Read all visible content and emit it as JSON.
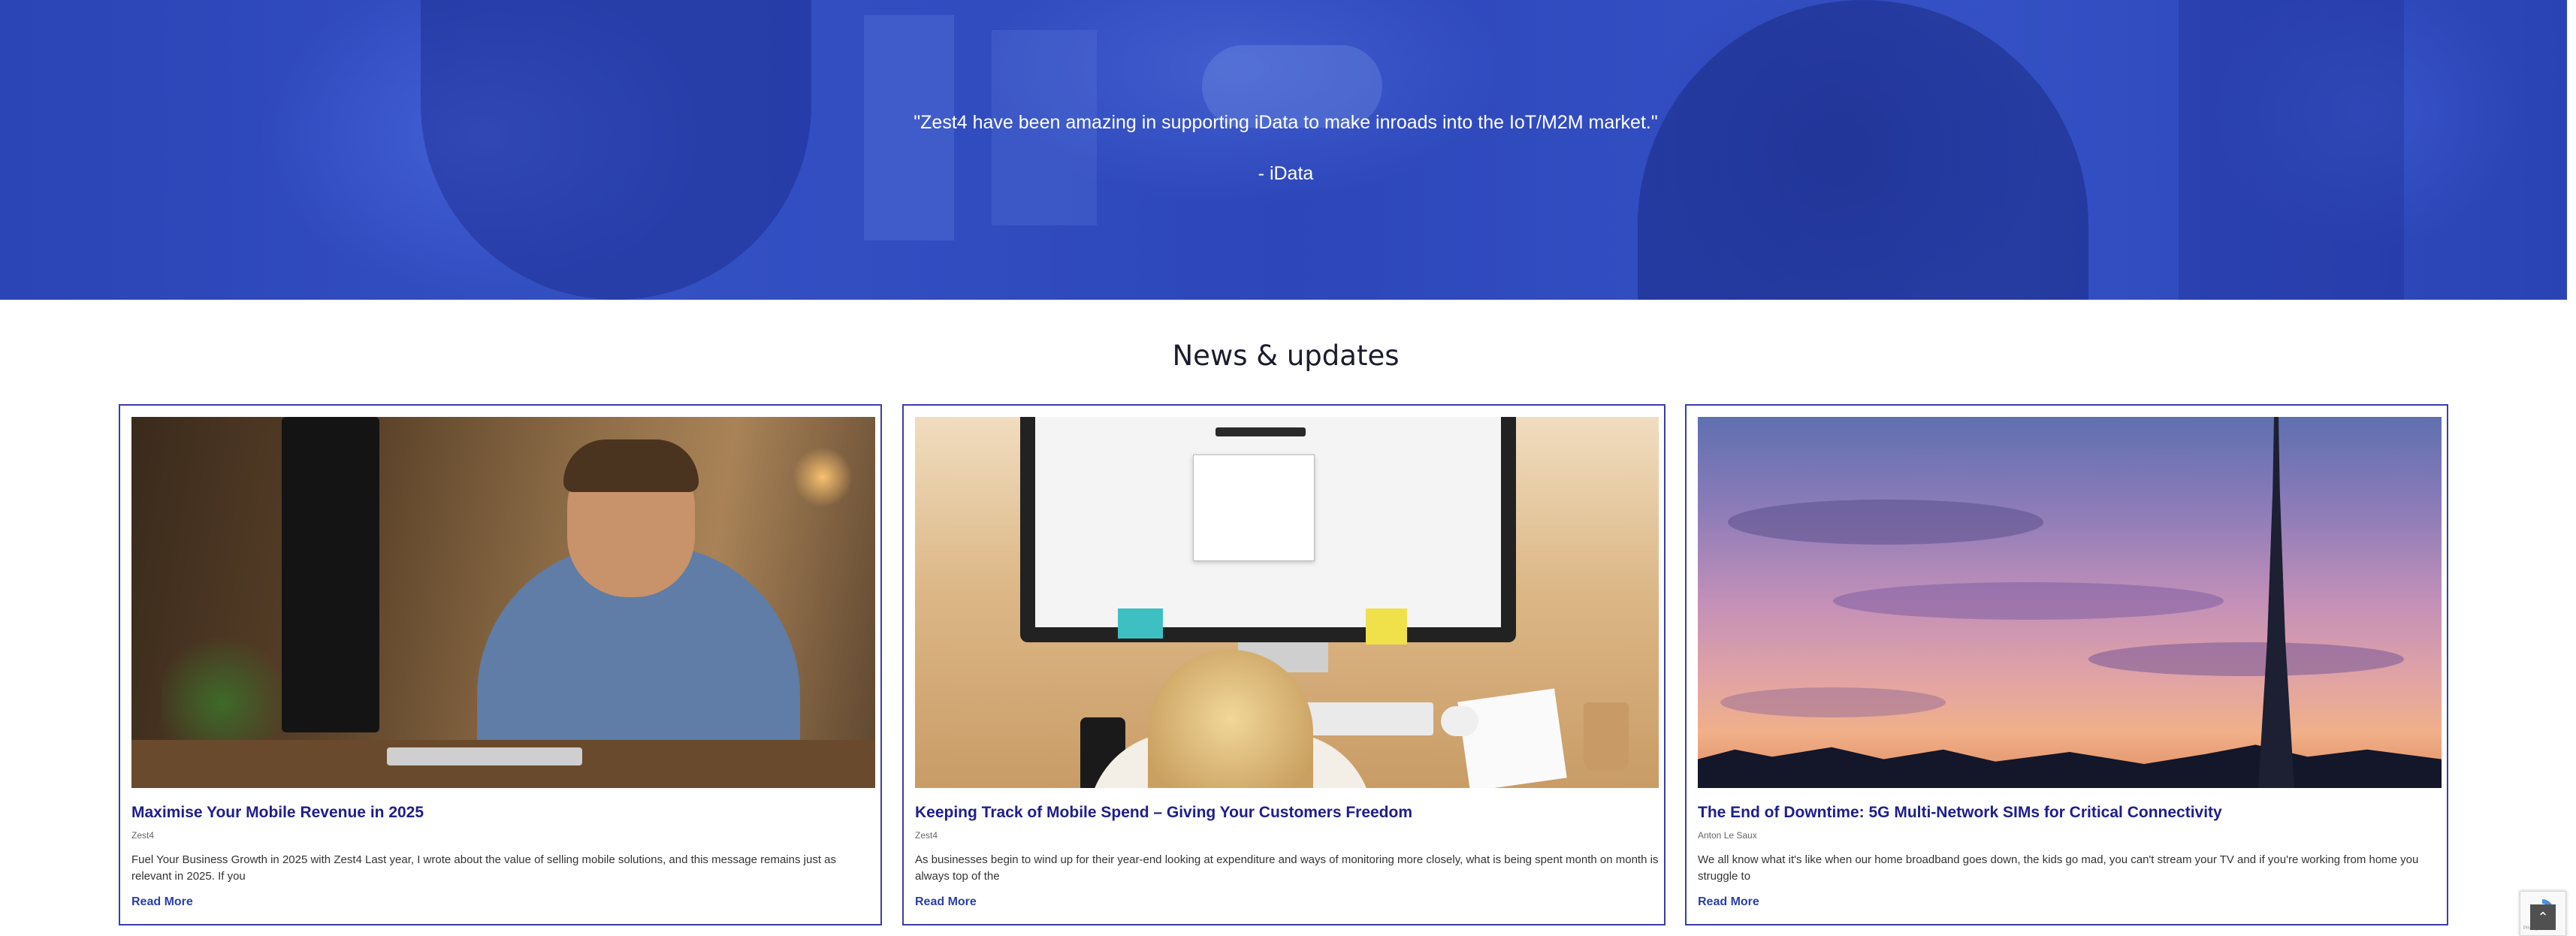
{
  "testimonial": {
    "quote": "\"Zest4 have been amazing in supporting iData to make inroads into the IoT/M2M market.\"",
    "attribution": "- iData"
  },
  "news": {
    "heading": "News & updates",
    "posts": [
      {
        "title": "Maximise Your Mobile Revenue in 2025",
        "author": "Zest4",
        "excerpt": "Fuel Your Business Growth in 2025 with Zest4 Last year, I wrote about the value of selling mobile solutions, and this message remains just as relevant in 2025. If you",
        "read_more": "Read More"
      },
      {
        "title": "Keeping Track of Mobile Spend – Giving Your Customers Freedom",
        "author": "Zest4",
        "excerpt": "As businesses begin to wind up for their year-end looking at expenditure and ways of monitoring more closely, what is being spent month on month is always top of the",
        "read_more": "Read More"
      },
      {
        "title": "The End of Downtime: 5G Multi-Network SIMs for Critical Connectivity",
        "author": "Anton Le Saux",
        "excerpt": "We all know what it's like when our home broadband goes down, the kids go mad, you can't stream your TV and if you're working from home you struggle to",
        "read_more": "Read More"
      }
    ]
  },
  "recaptcha": {
    "text": "Privacy - Terms"
  },
  "scroll_top": {
    "icon": "chevron-up-icon",
    "glyph": "⌃"
  },
  "colors": {
    "hero_blue": "#3451c4",
    "card_border": "#3c3cab",
    "post_title": "#1e1e8c",
    "read_more": "#2c3fa8"
  }
}
